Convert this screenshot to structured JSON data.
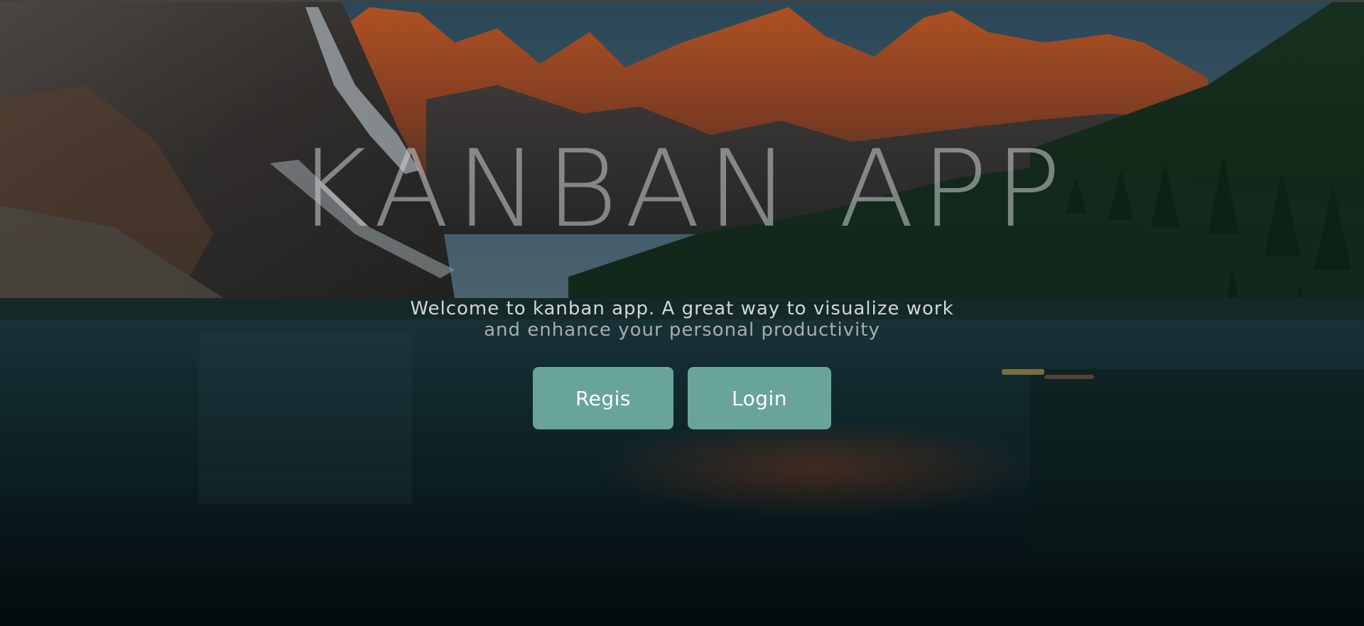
{
  "hero": {
    "title": "KANBAN APP",
    "subtitle_line1": "Welcome to kanban app. A great way to visualize work",
    "subtitle_line2": "and enhance your personal productivity"
  },
  "actions": {
    "register_label": "Regis",
    "login_label": "Login"
  },
  "colors": {
    "button_bg": "#68a39c",
    "button_text": "#ffffff",
    "title_text": "#cdd2d6",
    "subtitle_text": "#d2d6d8"
  }
}
